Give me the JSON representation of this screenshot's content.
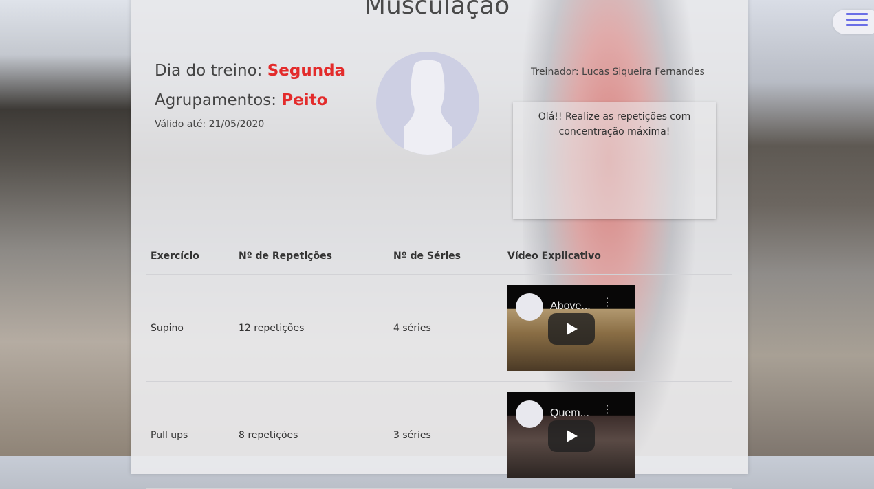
{
  "page": {
    "title": "Musculação"
  },
  "workout": {
    "day_label": "Dia do treino: ",
    "day_value": "Segunda",
    "group_label": "Agrupamentos: ",
    "group_value": "Peito",
    "valid_until": "Válido até: 21/05/2020"
  },
  "trainer": {
    "label": "Treinador: Lucas Siqueira Fernandes",
    "message": "Olá!! Realize as repetições com concentração máxima!"
  },
  "table": {
    "headers": [
      "Exercício",
      "Nº de Repetições",
      "Nº de Séries",
      "Vídeo Explicativo"
    ],
    "rows": [
      {
        "exercise": "Supino",
        "reps": "12 repetições",
        "sets": "4 séries",
        "video_title": "Above...",
        "video_menu": "⋮"
      },
      {
        "exercise": "Pull ups",
        "reps": "8 repetições",
        "sets": "3 séries",
        "video_title": "Quem...",
        "video_menu": "⋮"
      }
    ]
  },
  "icons": {
    "menu": "hamburger-menu-icon",
    "avatar": "user-silhouette-icon",
    "play": "play-icon"
  },
  "colors": {
    "highlight": "#e32b2b",
    "menu_accent": "#6a6ee6"
  }
}
